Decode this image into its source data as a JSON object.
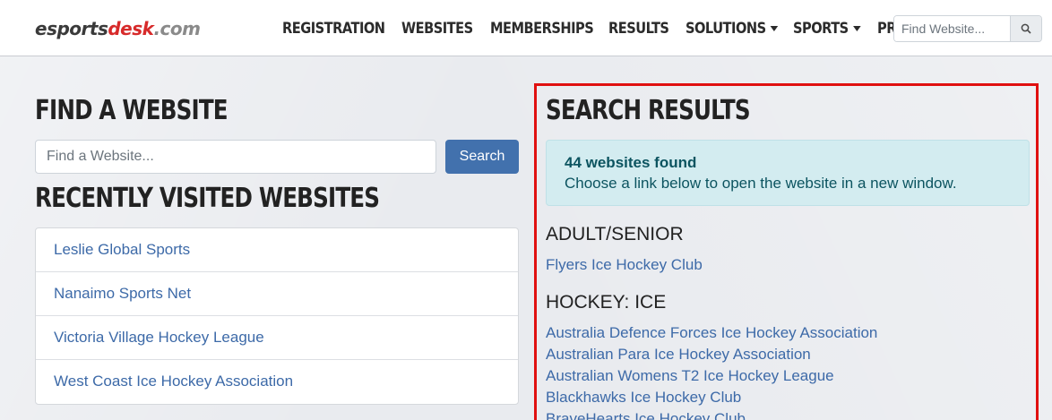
{
  "header": {
    "logo": {
      "part1": "esports",
      "part2": "desk",
      "part3": ".com"
    },
    "nav": [
      {
        "label": "REGISTRATION",
        "dropdown": false
      },
      {
        "label": "WEBSITES",
        "dropdown": false
      },
      {
        "label": "MEMBERSHIPS",
        "dropdown": false
      },
      {
        "label": "RESULTS",
        "dropdown": false
      },
      {
        "label": "SOLUTIONS",
        "dropdown": true
      },
      {
        "label": "SPORTS",
        "dropdown": true
      },
      {
        "label": "PRICING",
        "dropdown": false
      }
    ],
    "search_placeholder": "Find Website..."
  },
  "find": {
    "title": "FIND A WEBSITE",
    "placeholder": "Find a Website...",
    "button": "Search"
  },
  "recent": {
    "title": "RECENTLY VISITED WEBSITES",
    "items": [
      "Leslie Global Sports",
      "Nanaimo Sports Net",
      "Victoria Village Hockey League",
      "West Coast Ice Hockey Association"
    ]
  },
  "results": {
    "title": "SEARCH RESULTS",
    "count_text": "44 websites found",
    "instruction": "Choose a link below to open the website in a new window.",
    "groups": [
      {
        "category": "ADULT/SENIOR",
        "links": [
          "Flyers Ice Hockey Club"
        ]
      },
      {
        "category": "HOCKEY: ICE",
        "links": [
          "Australia Defence Forces Ice Hockey Association",
          "Australian Para Ice Hockey Association",
          "Australian Womens T2 Ice Hockey League",
          "Blackhawks Ice Hockey Club",
          "BraveHearts Ice Hockey Club"
        ]
      }
    ]
  },
  "colors": {
    "accent": "#4271ad",
    "link": "#3d6aa8",
    "highlight_border": "#e01010",
    "alert_bg": "#d3ecf0",
    "alert_text": "#0c5460"
  }
}
